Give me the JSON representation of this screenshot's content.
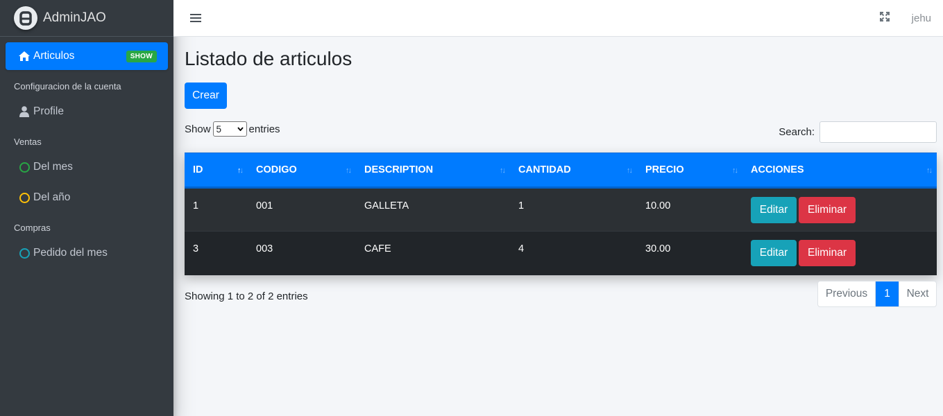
{
  "brand": {
    "name_bold": "Admin",
    "name_light": "JAO"
  },
  "sidebar": {
    "active_item": {
      "label": "Articulos",
      "badge": "SHOW"
    },
    "sections": [
      {
        "header": "Configuracion de la cuenta",
        "items": [
          {
            "label": "Profile",
            "icon": "user-icon"
          }
        ]
      },
      {
        "header": "Ventas",
        "items": [
          {
            "label": "Del mes",
            "icon": "circle-icon",
            "color": "#28a745"
          },
          {
            "label": "Del año",
            "icon": "circle-icon",
            "color": "#ffc107"
          }
        ]
      },
      {
        "header": "Compras",
        "items": [
          {
            "label": "Pedido del mes",
            "icon": "circle-icon",
            "color": "#17a2b8"
          }
        ]
      }
    ]
  },
  "topbar": {
    "user": "jehu"
  },
  "main": {
    "title": "Listado de articulos",
    "create_button": "Crear",
    "show_label": "Show",
    "entries_label": "entries",
    "entries_selected": "5",
    "search_label": "Search:",
    "search_value": ""
  },
  "table": {
    "columns": [
      "ID",
      "CODIGO",
      "DESCRIPTION",
      "CANTIDAD",
      "PRECIO",
      "ACCIONES"
    ],
    "rows": [
      {
        "id": "1",
        "codigo": "001",
        "description": "GALLETA",
        "cantidad": "1",
        "precio": "10.00"
      },
      {
        "id": "3",
        "codigo": "003",
        "description": "CAFE",
        "cantidad": "4",
        "precio": "30.00"
      }
    ],
    "edit_label": "Editar",
    "delete_label": "Eliminar"
  },
  "footer": {
    "info": "Showing 1 to 2 of 2 entries",
    "previous": "Previous",
    "current_page": "1",
    "next": "Next"
  },
  "colors": {
    "primary": "#007bff",
    "info": "#17a2b8",
    "danger": "#dc3545",
    "success": "#28a745"
  }
}
